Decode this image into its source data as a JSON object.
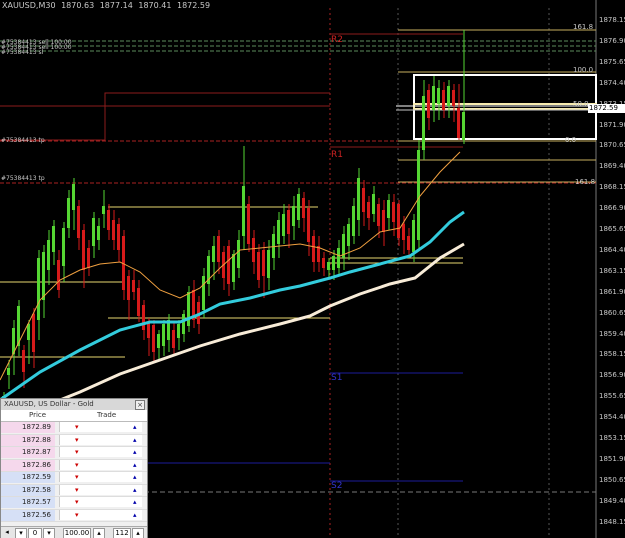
{
  "window": {
    "symbol_title": "XAUUSD,M30",
    "ohlc": [
      "1870.63",
      "1877.14",
      "1870.41",
      "1872.59"
    ]
  },
  "axis": {
    "price_labels": [
      "1878.15",
      "1876.90",
      "1875.65",
      "1874.40",
      "1873.15",
      "1871.90",
      "1870.65",
      "1869.40",
      "1868.15",
      "1866.90",
      "1865.65",
      "1864.40",
      "1863.15",
      "1861.90",
      "1860.65",
      "1859.40",
      "1858.15",
      "1856.90",
      "1855.65",
      "1854.40",
      "1853.15",
      "1851.90",
      "1850.65",
      "1849.40",
      "1848.15",
      "1846.90"
    ],
    "current_price": "1872.59"
  },
  "levels": {
    "r2": "R2",
    "r1": "R1",
    "s1": "S1",
    "s2": "S2",
    "fib_161_top": "161.8",
    "fib_100": "100.0",
    "fib_50": "50.0",
    "fib_0": "0.0",
    "fib_161_low": "161.8"
  },
  "orders": {
    "stack_line1": "#75384413 sell 100.00",
    "stack_line2": "#75384413 sell 100.00",
    "stack_line3": "#75384413 sl",
    "tp_line1": "#75384413 tp",
    "tp_line2": "#75384413 tp"
  },
  "market_watch": {
    "title": "XAUUSD, US Dollar - Gold",
    "col_price": "Price",
    "col_trade": "Trade",
    "ask_rows": [
      "1872.89",
      "1872.88",
      "1872.87",
      "1872.86"
    ],
    "bid_rows": [
      "1872.59",
      "1872.58",
      "1872.57",
      "1872.56"
    ],
    "down_glyph": "▾",
    "up_glyph": "▴",
    "footer": {
      "left_val": "0",
      "lot": "100.00",
      "qty": "112"
    }
  },
  "colors": {
    "background": "#000000",
    "bull": "#55d633",
    "bear": "#d61a1a",
    "ma_fast": "#f0a040",
    "ma_mid": "#33ccdd",
    "ma_slow": "#f8ecd8",
    "pivot_red": "#8b1c1c",
    "pivot_blue": "#1c1c9a"
  }
}
